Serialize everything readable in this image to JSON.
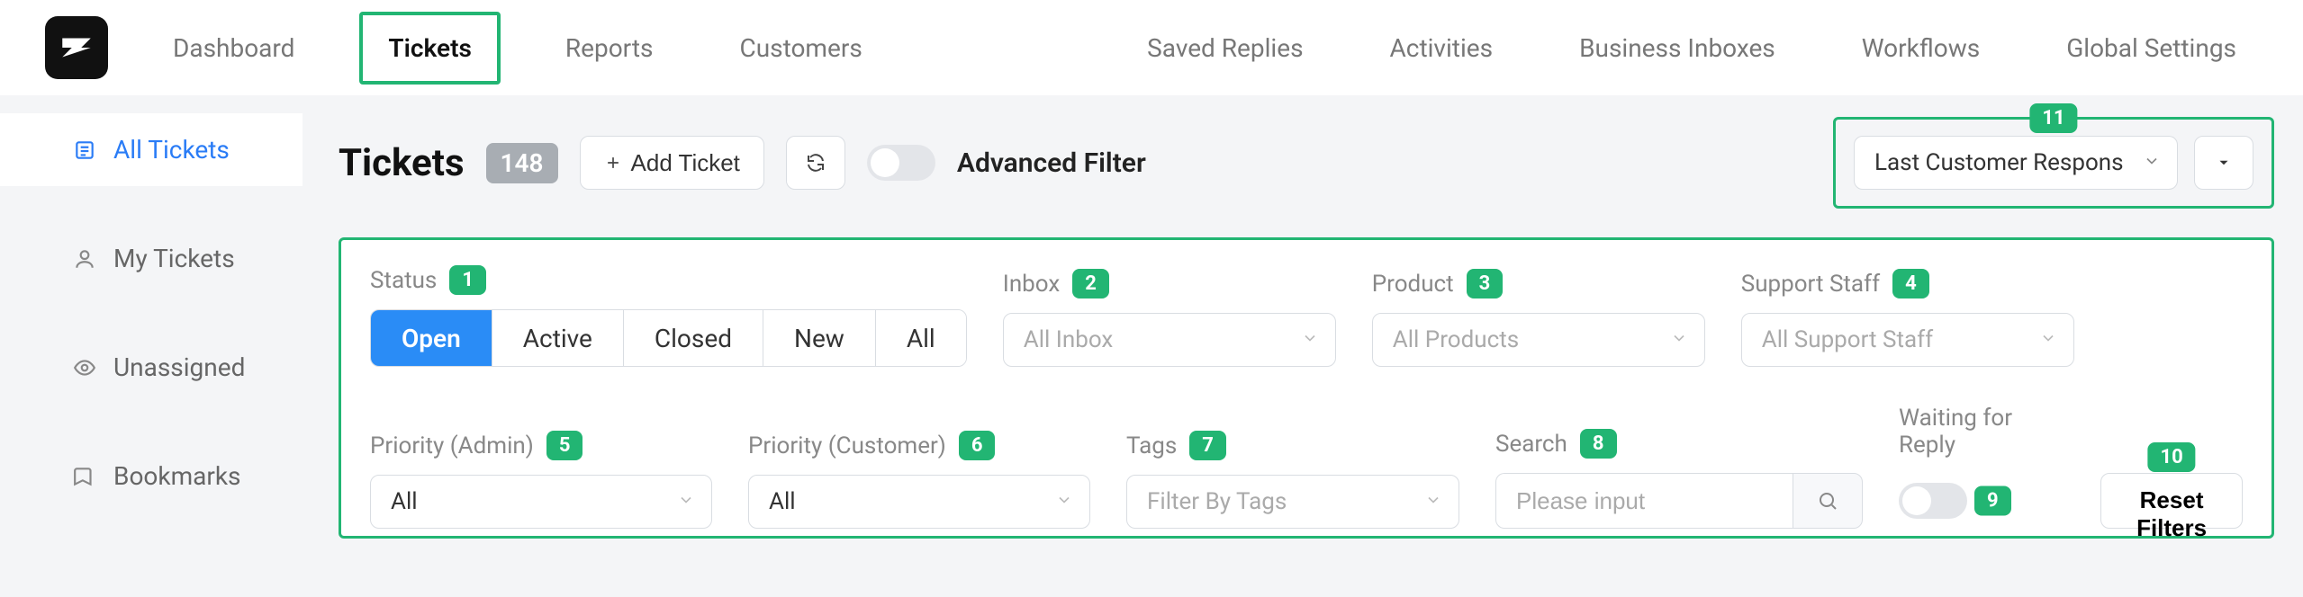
{
  "nav": {
    "left": [
      "Dashboard",
      "Tickets",
      "Reports",
      "Customers"
    ],
    "active_left": "Tickets",
    "right": [
      "Saved Replies",
      "Activities",
      "Business Inboxes",
      "Workflows",
      "Global Settings"
    ]
  },
  "sidebar": {
    "items": [
      {
        "label": "All Tickets",
        "active": true
      },
      {
        "label": "My Tickets",
        "active": false
      },
      {
        "label": "Unassigned",
        "active": false
      },
      {
        "label": "Bookmarks",
        "active": false
      }
    ]
  },
  "header": {
    "title": "Tickets",
    "count": "148",
    "add_label": "Add Ticket",
    "advanced_filter_label": "Advanced Filter",
    "sort_value": "Last Customer Respons",
    "badge_sort": "11"
  },
  "filters": {
    "status": {
      "label": "Status",
      "badge": "1",
      "options": [
        "Open",
        "Active",
        "Closed",
        "New",
        "All"
      ],
      "selected": "Open"
    },
    "inbox": {
      "label": "Inbox",
      "badge": "2",
      "placeholder": "All Inbox"
    },
    "product": {
      "label": "Product",
      "badge": "3",
      "placeholder": "All Products"
    },
    "support_staff": {
      "label": "Support Staff",
      "badge": "4",
      "placeholder": "All Support Staff"
    },
    "priority_admin": {
      "label": "Priority (Admin)",
      "badge": "5",
      "value": "All"
    },
    "priority_customer": {
      "label": "Priority (Customer)",
      "badge": "6",
      "value": "All"
    },
    "tags": {
      "label": "Tags",
      "badge": "7",
      "placeholder": "Filter By Tags"
    },
    "search": {
      "label": "Search",
      "badge": "8",
      "placeholder": "Please input"
    },
    "waiting": {
      "label": "Waiting for Reply",
      "badge": "9"
    },
    "reset": {
      "label": "Reset Filters",
      "badge": "10"
    }
  }
}
